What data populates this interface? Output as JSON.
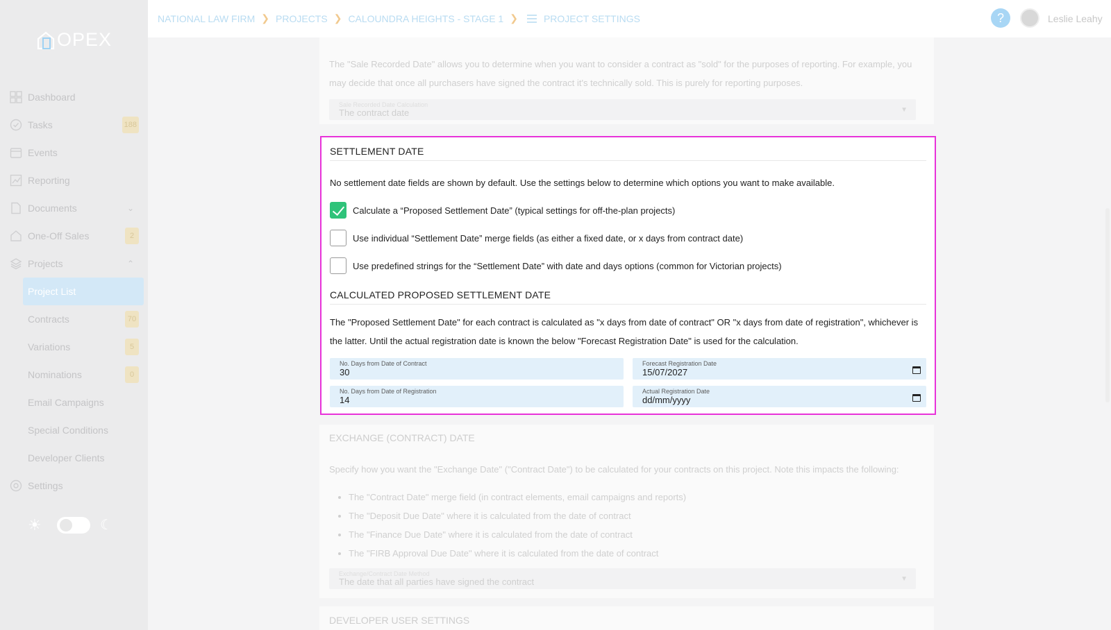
{
  "app": {
    "logo_text": "OPEX"
  },
  "sidebar": {
    "items": [
      {
        "label": "Dashboard",
        "icon": "dashboard-icon"
      },
      {
        "label": "Tasks",
        "icon": "check-circle-icon",
        "badge": "188"
      },
      {
        "label": "Events",
        "icon": "calendar-icon"
      },
      {
        "label": "Reporting",
        "icon": "chart-icon"
      },
      {
        "label": "Documents",
        "icon": "document-icon",
        "chevron": "⌄"
      },
      {
        "label": "One-Off Sales",
        "icon": "home-icon",
        "badge": "2"
      },
      {
        "label": "Projects",
        "icon": "layers-icon",
        "chevron": "⌃"
      },
      {
        "label": "Settings",
        "icon": "settings-icon"
      }
    ],
    "subitems": [
      {
        "label": "Project List",
        "active": true
      },
      {
        "label": "Contracts",
        "badge": "70"
      },
      {
        "label": "Variations",
        "badge": "5"
      },
      {
        "label": "Nominations",
        "badge": "0"
      },
      {
        "label": "Email Campaigns"
      },
      {
        "label": "Special Conditions"
      },
      {
        "label": "Developer Clients"
      }
    ]
  },
  "topbar": {
    "breadcrumbs": [
      "NATIONAL LAW FIRM",
      "PROJECTS",
      "CALOUNDRA HEIGHTS - STAGE 1",
      "PROJECT SETTINGS"
    ],
    "help": "?",
    "user_name": "Leslie Leahy"
  },
  "sale_recorded": {
    "text": "The \"Sale Recorded Date\" allows you to determine when you want to consider a contract as \"sold\" for the purposes of reporting. For example, you may decide that once all purchasers have signed the contract it's technically sold. This is purely for reporting purposes.",
    "select_label": "Sale Recorded Date Calculation",
    "select_value": "The contract date"
  },
  "settlement": {
    "title": "SETTLEMENT DATE",
    "intro": "No settlement date fields are shown by default. Use the settings below to determine which options you want to make available.",
    "options": [
      {
        "label": "Calculate a “Proposed Settlement Date” (typical settings for off-the-plan projects)",
        "checked": true
      },
      {
        "label": "Use individual “Settlement Date” merge fields (as either a fixed date, or x days from contract date)",
        "checked": false
      },
      {
        "label": "Use predefined strings for the “Settlement Date” with date and days options (common for Victorian projects)",
        "checked": false
      }
    ],
    "calc_title": "CALCULATED PROPOSED SETTLEMENT DATE",
    "calc_text": "The \"Proposed Settlement Date\" for each contract is calculated as \"x days from date of contract\" OR \"x days from date of registration\", whichever is the latter. Until the actual registration date is known the below \"Forecast Registration Date\" is used for the calculation.",
    "fields": {
      "days_contract_label": "No. Days from Date of Contract",
      "days_contract_value": "30",
      "forecast_label": "Forecast Registration Date",
      "forecast_value": "15/07/2027",
      "days_registration_label": "No. Days from Date of Registration",
      "days_registration_value": "14",
      "actual_label": "Actual Registration Date",
      "actual_value": "dd/mm/yyyy"
    }
  },
  "exchange": {
    "title": "EXCHANGE (CONTRACT) DATE",
    "intro": "Specify how you want the \"Exchange Date\" (\"Contract Date\") to be calculated for your contracts on this project. Note this impacts the following:",
    "bullets": [
      "The \"Contract Date\" merge field (in contract elements, email campaigns and reports)",
      "The \"Deposit Due Date\" where it is calculated from the date of contract",
      "The \"Finance Due Date\" where it is calculated from the date of contract",
      "The \"FIRB Approval Due Date\" where it is calculated from the date of contract"
    ],
    "select_label": "Exchange/Contract Date Method",
    "select_value": "The date that all parties have signed the contract"
  },
  "developer": {
    "title": "DEVELOPER USER SETTINGS"
  },
  "theme": {
    "sun": "☀",
    "moon": "☾"
  },
  "colors": {
    "accent": "#e832d9",
    "check": "#2fc37a",
    "field_bg": "#e2f0fa"
  }
}
